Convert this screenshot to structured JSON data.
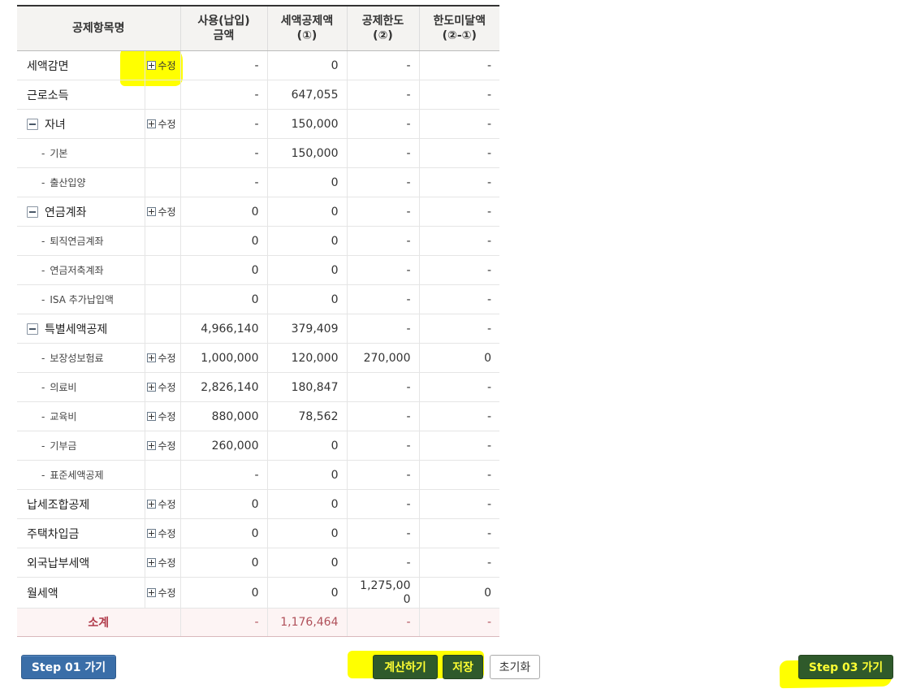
{
  "table": {
    "headers": {
      "name": "공제항목명",
      "used_line1": "사용(납입)",
      "used_line2": "금액",
      "credit_line1": "세액공제액",
      "credit_line2": "(①)",
      "limit_line1": "공제한도",
      "limit_line2": "(②)",
      "short_line1": "한도미달액",
      "short_line2": "(②-①)"
    },
    "edit_label": "수정",
    "rows": [
      {
        "name": "세액감면",
        "used": "-",
        "credit": "0",
        "limit": "-",
        "short": "-"
      },
      {
        "name": "근로소득",
        "used": "-",
        "credit": "647,055",
        "limit": "-",
        "short": "-"
      },
      {
        "name": "자녀",
        "used": "-",
        "credit": "150,000",
        "limit": "-",
        "short": "-"
      },
      {
        "name": "기본",
        "used": "-",
        "credit": "150,000",
        "limit": "-",
        "short": "-"
      },
      {
        "name": "출산입양",
        "used": "-",
        "credit": "0",
        "limit": "-",
        "short": "-"
      },
      {
        "name": "연금계좌",
        "used": "0",
        "credit": "0",
        "limit": "-",
        "short": "-"
      },
      {
        "name": "퇴직연금계좌",
        "used": "0",
        "credit": "0",
        "limit": "-",
        "short": "-"
      },
      {
        "name": "연금저축계좌",
        "used": "0",
        "credit": "0",
        "limit": "-",
        "short": "-"
      },
      {
        "name": "ISA 추가납입액",
        "used": "0",
        "credit": "0",
        "limit": "-",
        "short": "-"
      },
      {
        "name": "특별세액공제",
        "used": "4,966,140",
        "credit": "379,409",
        "limit": "-",
        "short": "-"
      },
      {
        "name": "보장성보험료",
        "used": "1,000,000",
        "credit": "120,000",
        "limit": "270,000",
        "short": "0"
      },
      {
        "name": "의료비",
        "used": "2,826,140",
        "credit": "180,847",
        "limit": "-",
        "short": "-"
      },
      {
        "name": "교육비",
        "used": "880,000",
        "credit": "78,562",
        "limit": "-",
        "short": "-"
      },
      {
        "name": "기부금",
        "used": "260,000",
        "credit": "0",
        "limit": "-",
        "short": "-"
      },
      {
        "name": "표준세액공제",
        "used": "-",
        "credit": "0",
        "limit": "-",
        "short": "-"
      },
      {
        "name": "납세조합공제",
        "used": "0",
        "credit": "0",
        "limit": "-",
        "short": "-"
      },
      {
        "name": "주택차입금",
        "used": "0",
        "credit": "0",
        "limit": "-",
        "short": "-"
      },
      {
        "name": "외국납부세액",
        "used": "0",
        "credit": "0",
        "limit": "-",
        "short": "-"
      },
      {
        "name": "월세액",
        "used": "0",
        "credit": "0",
        "limit": "1,275,000",
        "short": "0"
      }
    ],
    "total": {
      "label": "소계",
      "used": "-",
      "credit": "1,176,464",
      "limit": "-",
      "short": "-"
    }
  },
  "buttons": {
    "step01": "Step 01 가기",
    "calculate": "계산하기",
    "save": "저장",
    "reset": "초기화",
    "step03": "Step 03 가기"
  },
  "colors": {
    "highlight": "#ffff00",
    "primary_button": "#3a6ea8",
    "action_button": "#2f5a2b",
    "total_text": "#b03a4a"
  }
}
